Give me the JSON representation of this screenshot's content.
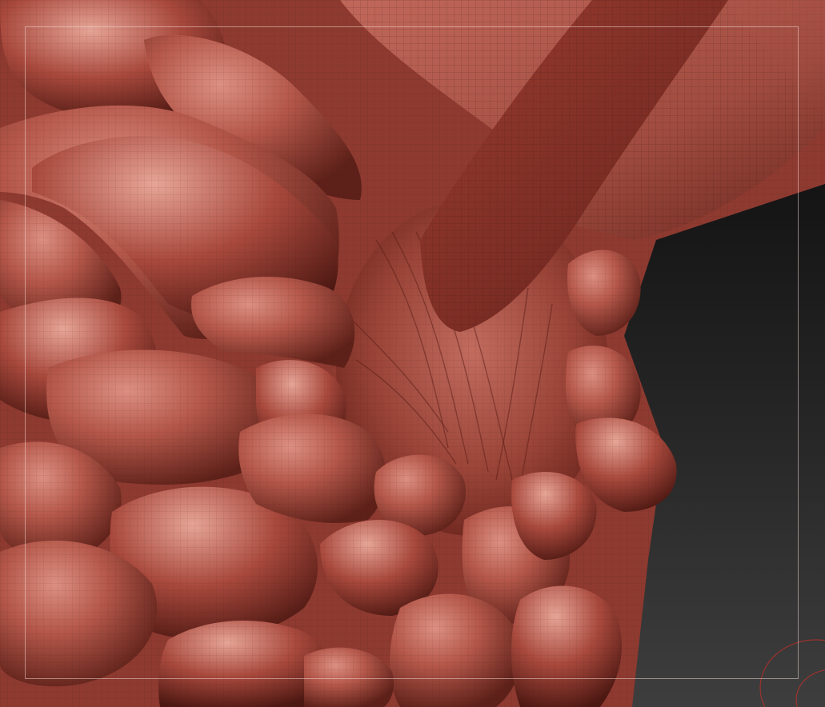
{
  "app": {
    "canvas_label": ""
  },
  "viewport": {
    "background_top": "#0b0b0b",
    "background_bottom": "#3e3e3e",
    "material_color": "#a8483c",
    "material_highlight": "#d98d80",
    "material_shadow": "#4a1a15",
    "frame_guide_color": "#ebd2cd",
    "gizmo_color": "#b0302a"
  },
  "icons": [
    "rotation-gizmo-icon"
  ]
}
